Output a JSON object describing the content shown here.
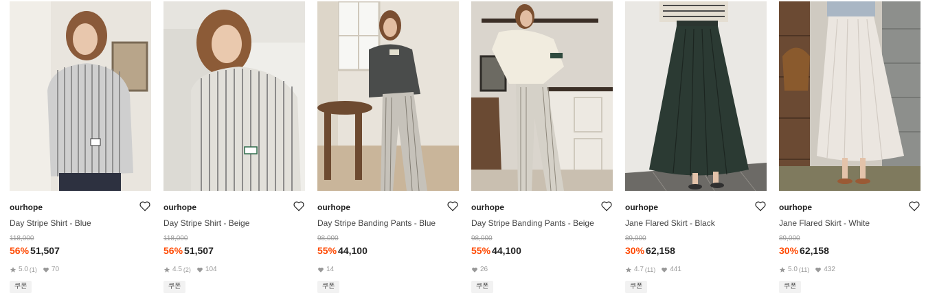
{
  "products": [
    {
      "brand": "ourhope",
      "name": "Day Stripe Shirt - Blue",
      "original_price": "118,000",
      "discount": "56%",
      "price": "51,507",
      "rating": "5.0",
      "reviews": "(1)",
      "likes": "70",
      "coupon": "쿠폰",
      "image": "model-stripe-shirt-blue"
    },
    {
      "brand": "ourhope",
      "name": "Day Stripe Shirt - Beige",
      "original_price": "118,000",
      "discount": "56%",
      "price": "51,507",
      "rating": "4.5",
      "reviews": "(2)",
      "likes": "104",
      "coupon": "쿠폰",
      "image": "model-stripe-shirt-beige"
    },
    {
      "brand": "ourhope",
      "name": "Day Stripe Banding Pants - Blue",
      "original_price": "98,000",
      "discount": "55%",
      "price": "44,100",
      "rating": "",
      "reviews": "",
      "likes": "14",
      "coupon": "쿠폰",
      "image": "model-banding-pants-blue"
    },
    {
      "brand": "ourhope",
      "name": "Day Stripe Banding Pants - Beige",
      "original_price": "98,000",
      "discount": "55%",
      "price": "44,100",
      "rating": "",
      "reviews": "",
      "likes": "26",
      "coupon": "쿠폰",
      "image": "model-banding-pants-beige"
    },
    {
      "brand": "ourhope",
      "name": "Jane Flared Skirt - Black",
      "original_price": "89,000",
      "discount": "30%",
      "price": "62,158",
      "rating": "4.7",
      "reviews": "(11)",
      "likes": "441",
      "coupon": "쿠폰",
      "image": "model-flared-skirt-black"
    },
    {
      "brand": "ourhope",
      "name": "Jane Flared Skirt - White",
      "original_price": "89,000",
      "discount": "30%",
      "price": "62,158",
      "rating": "5.0",
      "reviews": "(11)",
      "likes": "432",
      "coupon": "쿠폰",
      "image": "model-flared-skirt-white"
    }
  ],
  "colors": {
    "discount": "#ff4800",
    "strike": "#999999",
    "text": "#222222"
  }
}
